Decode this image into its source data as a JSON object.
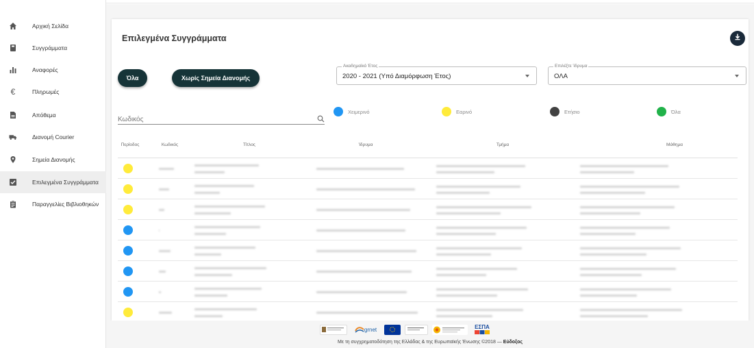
{
  "sidebar": {
    "items": [
      {
        "label": "Αρχική Σελίδα",
        "icon": "home-icon"
      },
      {
        "label": "Συγγράμματα",
        "icon": "book-icon"
      },
      {
        "label": "Αναφορές",
        "icon": "bar-chart-icon"
      },
      {
        "label": "Πληρωμές",
        "icon": "euro-icon"
      },
      {
        "label": "Απόθεμα",
        "icon": "document-icon"
      },
      {
        "label": "Διανομή Courier",
        "icon": "truck-icon"
      },
      {
        "label": "Σημεία Διανομής",
        "icon": "location-pin-icon"
      },
      {
        "label": "Επιλεγμένα Συγγράμματα",
        "icon": "checkbox-icon",
        "active": true
      },
      {
        "label": "Παραγγελίες Βιβλιοθηκών",
        "icon": "clipboard-icon"
      }
    ]
  },
  "main": {
    "title": "Επιλεγμένα Συγγράμματα",
    "btn_all": "Όλα",
    "btn_no_points": "Χωρίς Σημεία Διανομής",
    "year_select": {
      "legend": "Ακαδημαϊκό Έτος",
      "value": "2020 - 2021 (Υπό Διαμόρφωση Έτος)"
    },
    "inst_select": {
      "legend": "Επιλέξτε Ίδρυμα",
      "value": "ΟΛΑ"
    },
    "search_placeholder": "Κωδικός",
    "legend": [
      {
        "label": "Χειμερινό",
        "color": "#2196f3"
      },
      {
        "label": "Εαρινό",
        "color": "#ffeb3b"
      },
      {
        "label": "Ετήσιο",
        "color": "#424242"
      },
      {
        "label": "Όλα",
        "color": "#21b24a"
      }
    ]
  },
  "table": {
    "headers": [
      "Περίοδος",
      "Κωδικός",
      "Τίτλος",
      "Ίδρυμα",
      "Τμήμα",
      "Μάθημα"
    ],
    "rows": [
      {
        "period_color": "#ffeb3b"
      },
      {
        "period_color": "#ffeb3b"
      },
      {
        "period_color": "#ffeb3b"
      },
      {
        "period_color": "#2196f3"
      },
      {
        "period_color": "#2196f3"
      },
      {
        "period_color": "#2196f3"
      },
      {
        "period_color": "#2196f3"
      },
      {
        "period_color": "#ffeb3b"
      }
    ]
  },
  "footer": {
    "text_prefix": "Με τη συγχρηματοδότηση της Ελλάδας & της Ευρωπαϊκής Ένωσης ©2018 —",
    "brand": "Εύδοξος",
    "logos": [
      "grnet",
      "ΕΣΠΑ"
    ]
  }
}
